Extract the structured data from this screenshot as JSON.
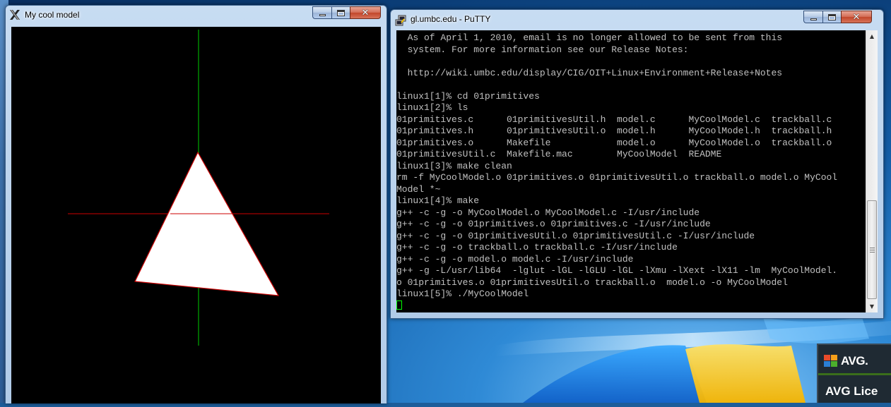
{
  "gl_window": {
    "title": "My cool model",
    "buttons": {
      "minimize": "minimize",
      "maximize": "maximize",
      "close": "close"
    }
  },
  "putty_window": {
    "title": "gl.umbc.edu - PuTTY",
    "terminal_lines": [
      "  As of April 1, 2010, email is no longer allowed to be sent from this",
      "  system. For more information see our Release Notes:",
      "",
      "  http://wiki.umbc.edu/display/CIG/OIT+Linux+Environment+Release+Notes",
      "",
      "linux1[1]% cd 01primitives",
      "linux1[2]% ls",
      "01primitives.c      01primitivesUtil.h  model.c      MyCoolModel.c  trackball.c",
      "01primitives.h      01primitivesUtil.o  model.h      MyCoolModel.h  trackball.h",
      "01primitives.o      Makefile            model.o      MyCoolModel.o  trackball.o",
      "01primitivesUtil.c  Makefile.mac        MyCoolModel  README",
      "linux1[3]% make clean",
      "rm -f MyCoolModel.o 01primitives.o 01primitivesUtil.o trackball.o model.o MyCool",
      "Model *~",
      "linux1[4]% make",
      "g++ -c -g -o MyCoolModel.o MyCoolModel.c -I/usr/include",
      "g++ -c -g -o 01primitives.o 01primitives.c -I/usr/include",
      "g++ -c -g -o 01primitivesUtil.o 01primitivesUtil.c -I/usr/include",
      "g++ -c -g -o trackball.o trackball.c -I/usr/include",
      "g++ -c -g -o model.o model.c -I/usr/include",
      "g++ -g -L/usr/lib64  -lglut -lGL -lGLU -lGL -lXmu -lXext -lX11 -lm  MyCoolModel.",
      "o 01primitives.o 01primitivesUtil.o trackball.o  model.o -o MyCoolModel",
      "linux1[5]% ./MyCoolModel"
    ],
    "colors": {
      "text": "#c0c0c0",
      "cursor": "#00ff00",
      "background": "#000000"
    }
  },
  "gl_scene": {
    "colors": {
      "triangle_fill": "#ffffff",
      "triangle_edge": "#cc0000",
      "x_axis": "#cc0000",
      "y_axis": "#00cc00",
      "background": "#000000"
    }
  },
  "avg": {
    "brand": "AVG.",
    "subtext": "AVG Lice"
  },
  "icons": {
    "gl_window_icon": "x-window-system-icon",
    "putty_icon": "putty-icon",
    "avg_logo": "avg-logo-icon"
  }
}
